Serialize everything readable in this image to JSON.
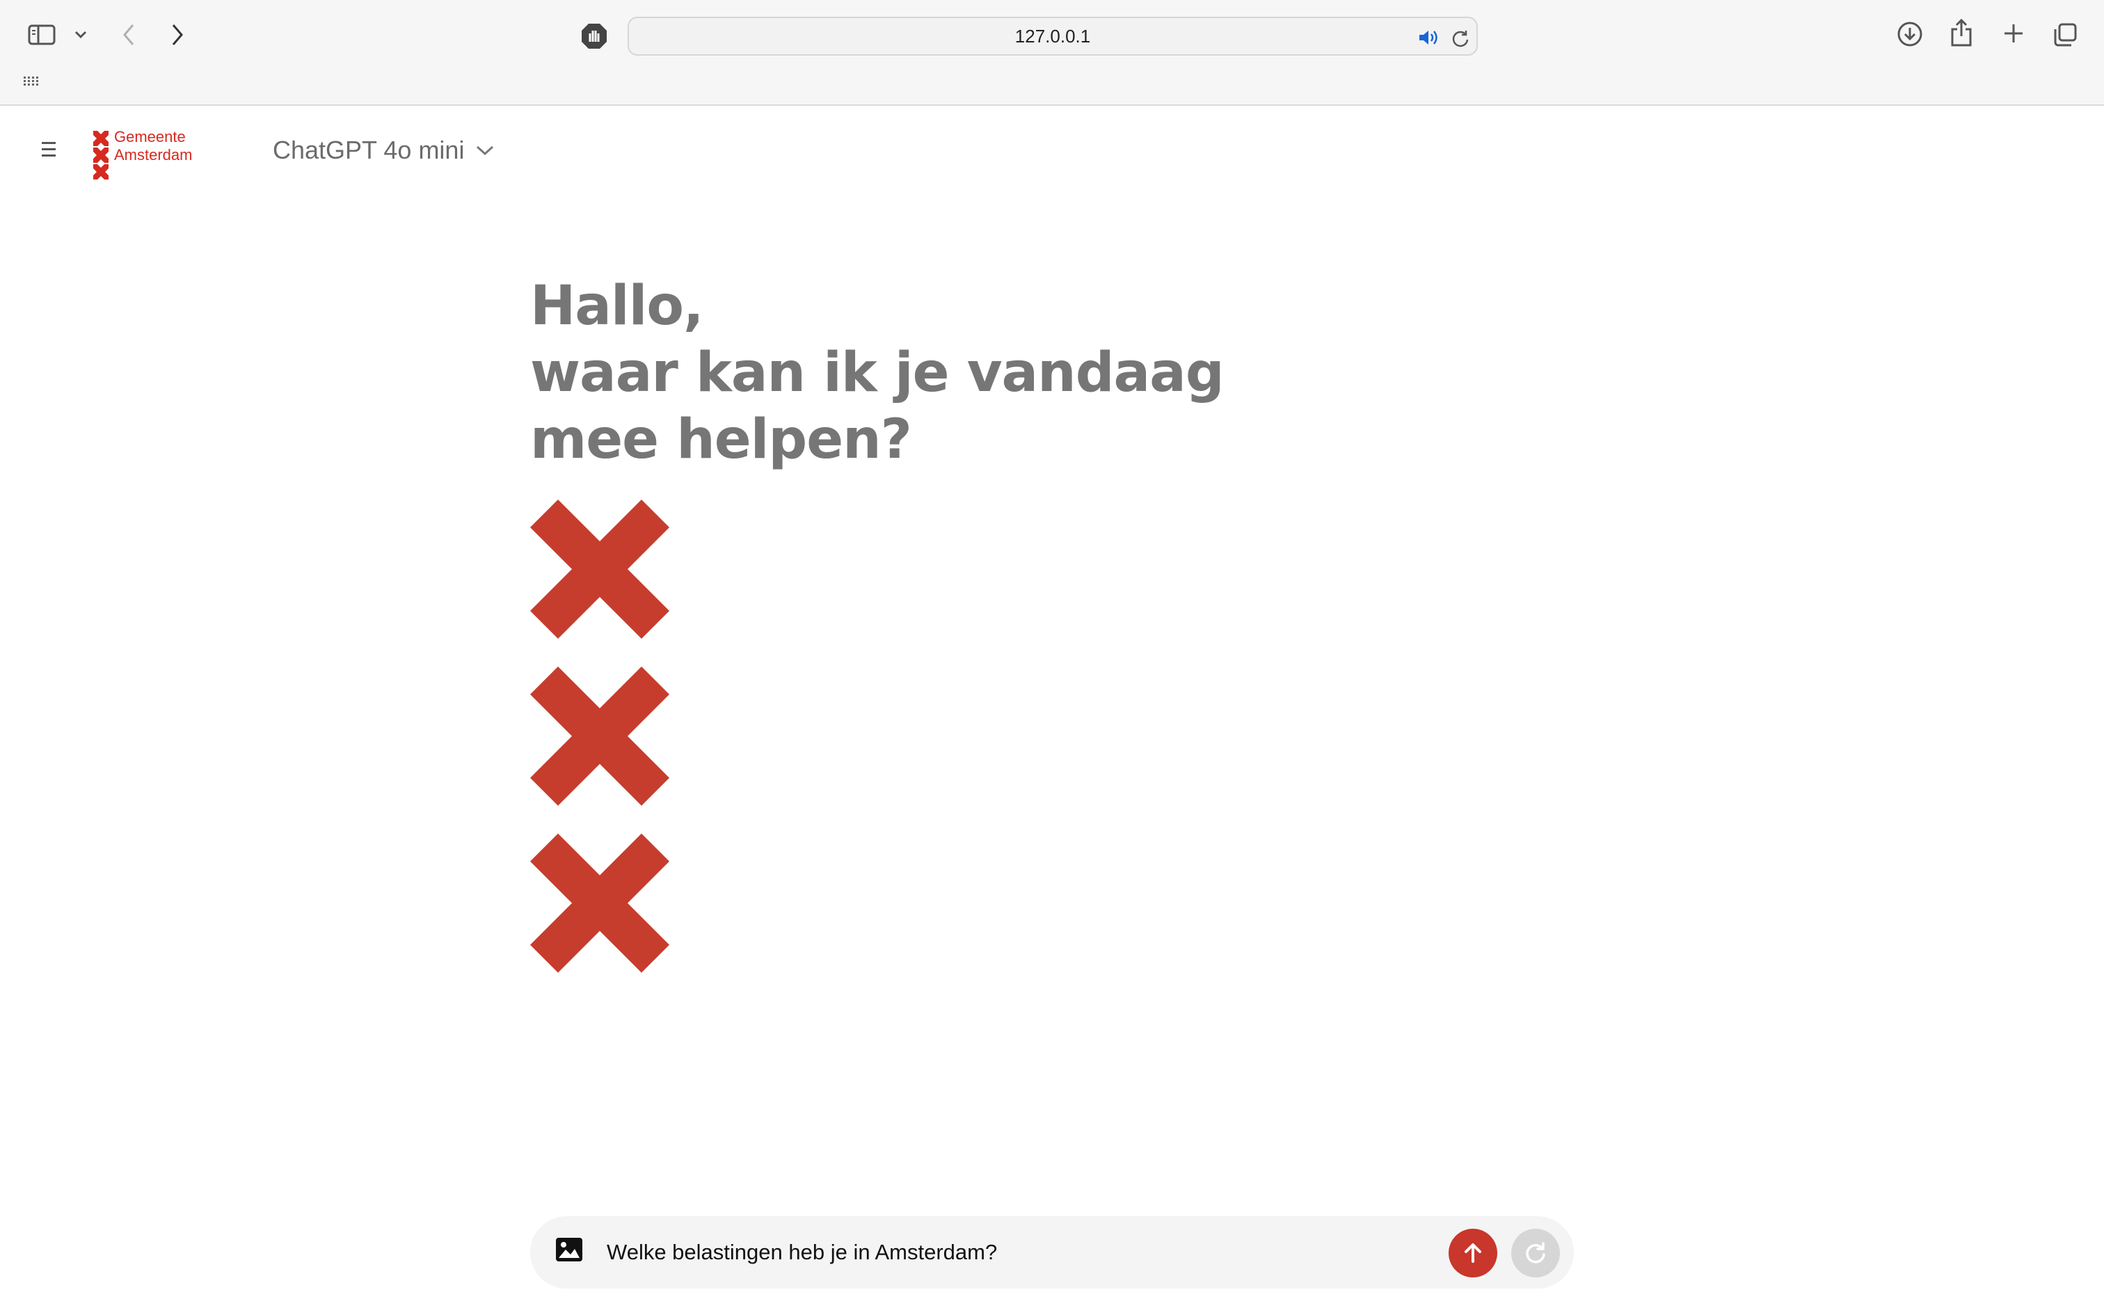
{
  "browser": {
    "url": "127.0.0.1",
    "icons": [
      "sidebar-toggle-icon",
      "chevron-down-icon",
      "back-arrow-icon",
      "forward-arrow-icon",
      "privacy-shield-icon",
      "speaker-icon",
      "reload-icon",
      "download-icon",
      "share-icon",
      "new-tab-plus-icon",
      "tab-overview-icon",
      "grid-dots-icon"
    ]
  },
  "header": {
    "menu_icon": "hamburger-icon",
    "logo": {
      "line1": "Gemeente",
      "line2": "Amsterdam"
    },
    "model_label": "ChatGPT 4o mini"
  },
  "hero": {
    "line1": "Hallo,",
    "line2": "waar kan ik je vandaag",
    "line3": "mee helpen?"
  },
  "composer": {
    "value": "Welke belastingen heb je in Amsterdam?",
    "image_icon": "image-icon",
    "send_icon": "arrow-up-icon",
    "reset_icon": "refresh-icon"
  },
  "colors": {
    "brand_red": "#c9362b",
    "logo_red": "#d62a20",
    "heading_gray": "#767676",
    "composer_bg": "#f4f4f4"
  }
}
